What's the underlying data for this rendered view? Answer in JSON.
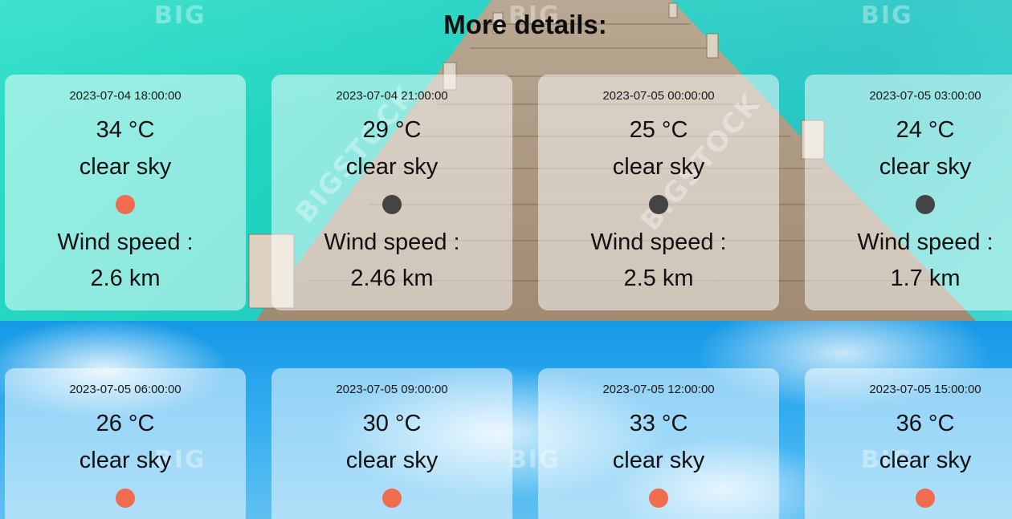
{
  "page": {
    "heading": "More details:"
  },
  "watermark": {
    "text": "BIG",
    "text_diagonal": "BIGSTOCK"
  },
  "colors": {
    "day_dot": "#ef6c4f",
    "night_dot": "#444444"
  },
  "forecast": [
    {
      "datetime": "2023-07-04 18:00:00",
      "temp": "34 °C",
      "desc": "clear sky",
      "icon": "sun-dot-icon",
      "wind_label": "Wind speed :",
      "wind_value": "2.6 km"
    },
    {
      "datetime": "2023-07-04 21:00:00",
      "temp": "29 °C",
      "desc": "clear sky",
      "icon": "moon-dot-icon",
      "wind_label": "Wind speed :",
      "wind_value": "2.46 km"
    },
    {
      "datetime": "2023-07-05 00:00:00",
      "temp": "25 °C",
      "desc": "clear sky",
      "icon": "moon-dot-icon",
      "wind_label": "Wind speed :",
      "wind_value": "2.5 km"
    },
    {
      "datetime": "2023-07-05 03:00:00",
      "temp": "24 °C",
      "desc": "clear sky",
      "icon": "moon-dot-icon",
      "wind_label": "Wind speed :",
      "wind_value": "1.7 km"
    },
    {
      "datetime": "2023-07-05 06:00:00",
      "temp": "26 °C",
      "desc": "clear sky",
      "icon": "sun-dot-icon"
    },
    {
      "datetime": "2023-07-05 09:00:00",
      "temp": "30 °C",
      "desc": "clear sky",
      "icon": "sun-dot-icon"
    },
    {
      "datetime": "2023-07-05 12:00:00",
      "temp": "33 °C",
      "desc": "clear sky",
      "icon": "sun-dot-icon"
    },
    {
      "datetime": "2023-07-05 15:00:00",
      "temp": "36 °C",
      "desc": "clear sky",
      "icon": "sun-dot-icon"
    }
  ]
}
